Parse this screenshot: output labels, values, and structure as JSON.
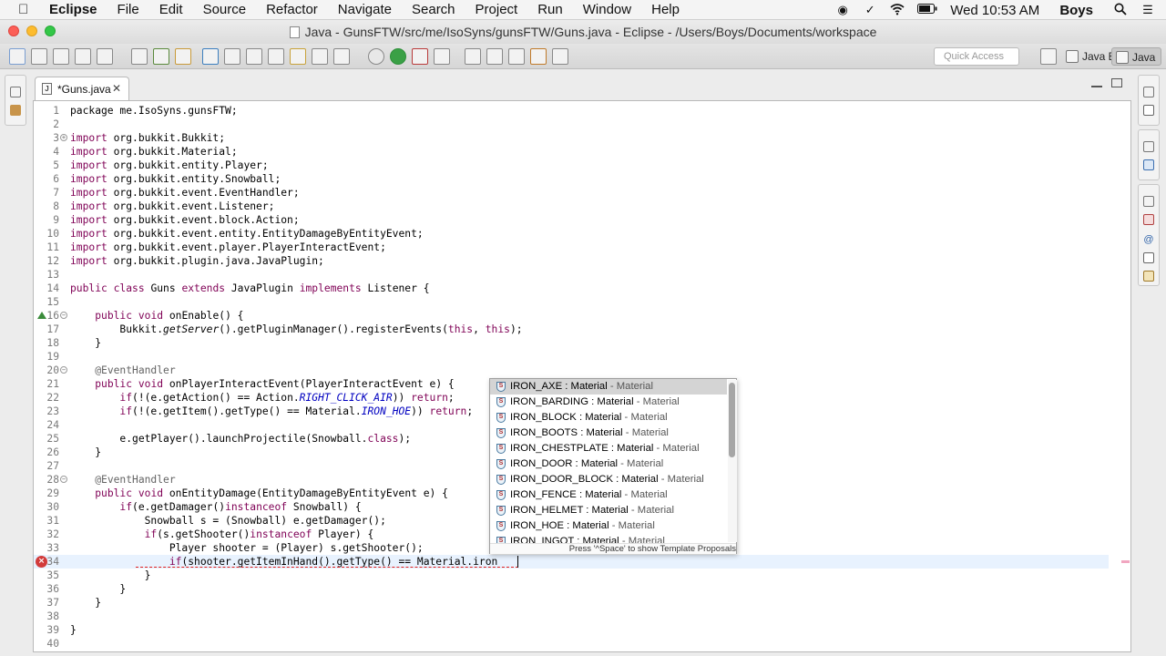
{
  "menubar": {
    "app_name": "Eclipse",
    "items": [
      "File",
      "Edit",
      "Source",
      "Refactor",
      "Navigate",
      "Search",
      "Project",
      "Run",
      "Window",
      "Help"
    ],
    "clock": "Wed 10:53 AM",
    "user": "Boys"
  },
  "window": {
    "title": "Java - GunsFTW/src/me/IsoSyns/gunsFTW/Guns.java - Eclipse - /Users/Boys/Documents/workspace"
  },
  "toolbar": {
    "quick_access_placeholder": "Quick Access",
    "perspectives": [
      "Java EE",
      "Java"
    ]
  },
  "editor": {
    "tab_label": "*Guns.java",
    "lines": [
      {
        "n": "1",
        "segs": [
          [
            "",
            "package me.IsoSyns.gunsFTW;"
          ]
        ]
      },
      {
        "n": "2",
        "segs": []
      },
      {
        "n": "3",
        "segs": [
          [
            "kw",
            "import"
          ],
          [
            "",
            " org.bukkit.Bukkit;"
          ]
        ]
      },
      {
        "n": "4",
        "segs": [
          [
            "kw",
            "import"
          ],
          [
            "",
            " org.bukkit.Material;"
          ]
        ]
      },
      {
        "n": "5",
        "segs": [
          [
            "kw",
            "import"
          ],
          [
            "",
            " org.bukkit.entity.Player;"
          ]
        ]
      },
      {
        "n": "6",
        "segs": [
          [
            "kw",
            "import"
          ],
          [
            "",
            " org.bukkit.entity.Snowball;"
          ]
        ]
      },
      {
        "n": "7",
        "segs": [
          [
            "kw",
            "import"
          ],
          [
            "",
            " org.bukkit.event.EventHandler;"
          ]
        ]
      },
      {
        "n": "8",
        "segs": [
          [
            "kw",
            "import"
          ],
          [
            "",
            " org.bukkit.event.Listener;"
          ]
        ]
      },
      {
        "n": "9",
        "segs": [
          [
            "kw",
            "import"
          ],
          [
            "",
            " org.bukkit.event.block.Action;"
          ]
        ]
      },
      {
        "n": "10",
        "segs": [
          [
            "kw",
            "import"
          ],
          [
            "",
            " org.bukkit.event.entity.EntityDamageByEntityEvent;"
          ]
        ]
      },
      {
        "n": "11",
        "segs": [
          [
            "kw",
            "import"
          ],
          [
            "",
            " org.bukkit.event.player.PlayerInteractEvent;"
          ]
        ]
      },
      {
        "n": "12",
        "segs": [
          [
            "kw",
            "import"
          ],
          [
            "",
            " org.bukkit.plugin.java.JavaPlugin;"
          ]
        ]
      },
      {
        "n": "13",
        "segs": []
      },
      {
        "n": "14",
        "segs": [
          [
            "kw",
            "public"
          ],
          [
            "",
            " "
          ],
          [
            "kw",
            "class"
          ],
          [
            "",
            " Guns "
          ],
          [
            "kw",
            "extends"
          ],
          [
            "",
            " JavaPlugin "
          ],
          [
            "kw",
            "implements"
          ],
          [
            "",
            " Listener {"
          ]
        ]
      },
      {
        "n": "15",
        "segs": []
      },
      {
        "n": "16",
        "segs": [
          [
            "",
            "    "
          ],
          [
            "kw",
            "public"
          ],
          [
            "",
            " "
          ],
          [
            "kw",
            "void"
          ],
          [
            "",
            " onEnable() {"
          ]
        ]
      },
      {
        "n": "17",
        "segs": [
          [
            "",
            "        Bukkit."
          ],
          [
            "it",
            "getServer"
          ],
          [
            "",
            "().getPluginManager().registerEvents("
          ],
          [
            "kw",
            "this"
          ],
          [
            "",
            ", "
          ],
          [
            "kw",
            "this"
          ],
          [
            "",
            ");"
          ]
        ]
      },
      {
        "n": "18",
        "segs": [
          [
            "",
            "    }"
          ]
        ]
      },
      {
        "n": "19",
        "segs": []
      },
      {
        "n": "20",
        "segs": [
          [
            "",
            "    "
          ],
          [
            "an",
            "@EventHandler"
          ]
        ]
      },
      {
        "n": "21",
        "segs": [
          [
            "",
            "    "
          ],
          [
            "kw",
            "public"
          ],
          [
            "",
            " "
          ],
          [
            "kw",
            "void"
          ],
          [
            "",
            " onPlayerInteractEvent(PlayerInteractEvent e) {"
          ]
        ]
      },
      {
        "n": "22",
        "segs": [
          [
            "",
            "        "
          ],
          [
            "kw",
            "if"
          ],
          [
            "",
            "(!(e.getAction() == Action."
          ],
          [
            "st",
            "RIGHT_CLICK_AIR"
          ],
          [
            "",
            ")) "
          ],
          [
            "kw",
            "return"
          ],
          [
            "",
            ";"
          ]
        ]
      },
      {
        "n": "23",
        "segs": [
          [
            "",
            "        "
          ],
          [
            "kw",
            "if"
          ],
          [
            "",
            "(!(e.getItem().getType() == Material."
          ],
          [
            "st",
            "IRON_HOE"
          ],
          [
            "",
            ")) "
          ],
          [
            "kw",
            "return"
          ],
          [
            "",
            ";"
          ]
        ]
      },
      {
        "n": "24",
        "segs": []
      },
      {
        "n": "25",
        "segs": [
          [
            "",
            "        e.getPlayer().launchProjectile(Snowball."
          ],
          [
            "kw",
            "class"
          ],
          [
            "",
            ");"
          ]
        ]
      },
      {
        "n": "26",
        "segs": [
          [
            "",
            "    }"
          ]
        ]
      },
      {
        "n": "27",
        "segs": []
      },
      {
        "n": "28",
        "segs": [
          [
            "",
            "    "
          ],
          [
            "an",
            "@EventHandler"
          ]
        ]
      },
      {
        "n": "29",
        "segs": [
          [
            "",
            "    "
          ],
          [
            "kw",
            "public"
          ],
          [
            "",
            " "
          ],
          [
            "kw",
            "void"
          ],
          [
            "",
            " onEntityDamage(EntityDamageByEntityEvent e) {"
          ]
        ]
      },
      {
        "n": "30",
        "segs": [
          [
            "",
            "        "
          ],
          [
            "kw",
            "if"
          ],
          [
            "",
            "(e.getDamager()"
          ],
          [
            "kw",
            "instanceof"
          ],
          [
            "",
            " Snowball) {"
          ]
        ]
      },
      {
        "n": "31",
        "segs": [
          [
            "",
            "            Snowball s = (Snowball) e.getDamager();"
          ]
        ]
      },
      {
        "n": "32",
        "segs": [
          [
            "",
            "            "
          ],
          [
            "kw",
            "if"
          ],
          [
            "",
            "(s.getShooter()"
          ],
          [
            "kw",
            "instanceof"
          ],
          [
            "",
            " Player) {"
          ]
        ]
      },
      {
        "n": "33",
        "segs": [
          [
            "",
            "                Player shooter = (Player) s.getShooter();"
          ]
        ]
      },
      {
        "n": "34",
        "segs": [
          [
            "",
            "                "
          ],
          [
            "kw",
            "if"
          ],
          [
            "",
            "(shooter.getItemInHand().getType() == Material.iron"
          ]
        ]
      },
      {
        "n": "35",
        "segs": [
          [
            "",
            "            }"
          ]
        ]
      },
      {
        "n": "36",
        "segs": [
          [
            "",
            "        }"
          ]
        ]
      },
      {
        "n": "37",
        "segs": [
          [
            "",
            "    }"
          ]
        ]
      },
      {
        "n": "38",
        "segs": []
      },
      {
        "n": "39",
        "segs": [
          [
            "",
            "}"
          ]
        ]
      },
      {
        "n": "40",
        "segs": []
      }
    ]
  },
  "autocomplete": {
    "proposals": [
      {
        "name": "IRON_AXE : Material",
        "type": " - Material"
      },
      {
        "name": "IRON_BARDING : Material",
        "type": " - Material"
      },
      {
        "name": "IRON_BLOCK : Material",
        "type": " - Material"
      },
      {
        "name": "IRON_BOOTS : Material",
        "type": " - Material"
      },
      {
        "name": "IRON_CHESTPLATE : Material",
        "type": " - Material"
      },
      {
        "name": "IRON_DOOR : Material",
        "type": " - Material"
      },
      {
        "name": "IRON_DOOR_BLOCK : Material",
        "type": " - Material"
      },
      {
        "name": "IRON_FENCE : Material",
        "type": " - Material"
      },
      {
        "name": "IRON_HELMET : Material",
        "type": " - Material"
      },
      {
        "name": "IRON_HOE : Material",
        "type": " - Material"
      },
      {
        "name": "IRON_INGOT : Material",
        "type": " - Material"
      }
    ],
    "status": "Press '^Space' to show Template Proposals"
  },
  "colors": {
    "keyword": "#7f0055",
    "static_field": "#0000c0",
    "annotation": "#646464",
    "error": "#d23b3b",
    "current_line": "#e8f2fe"
  }
}
